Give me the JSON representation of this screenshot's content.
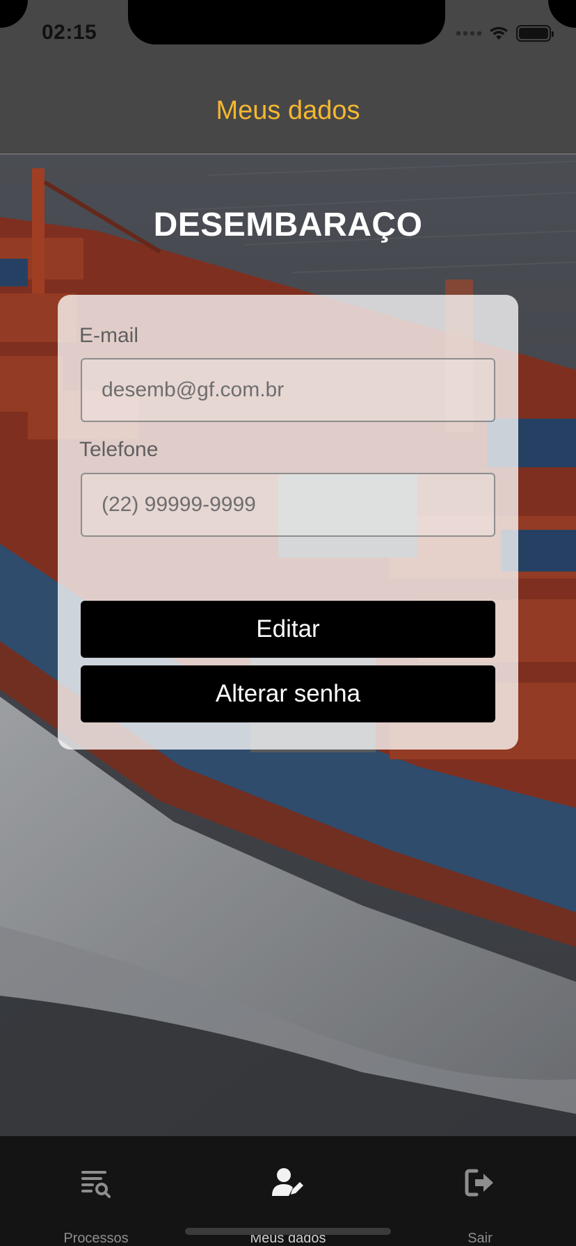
{
  "status_bar": {
    "time": "02:15"
  },
  "header": {
    "title": "Meus dados"
  },
  "brand": {
    "title": "DESEMBARAÇO"
  },
  "form": {
    "email_label": "E-mail",
    "email_value": "desemb@gf.com.br",
    "phone_label": "Telefone",
    "phone_value": "(22) 99999-9999",
    "edit_button": "Editar",
    "change_password_button": "Alterar senha"
  },
  "tabs": [
    {
      "label": "Processos",
      "icon": "list-search-icon"
    },
    {
      "label": "Meus dados",
      "icon": "user-edit-icon",
      "active": true
    },
    {
      "label": "Sair",
      "icon": "sign-out-icon"
    }
  ],
  "colors": {
    "accent": "#f5b730",
    "header_bg": "#474747",
    "tabbar_bg": "#141414",
    "button_bg": "#000000"
  }
}
